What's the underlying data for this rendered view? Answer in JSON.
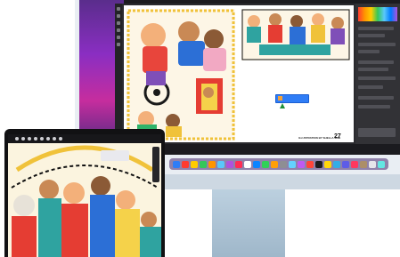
{
  "imac": {
    "app": {
      "artwork_caption": "ILLUSTRATION BY SHELLA SHIE",
      "page_number": "27"
    },
    "dock_icon_colors": [
      "#2e7df6",
      "#ff3b30",
      "#ffcc00",
      "#34c759",
      "#ff9500",
      "#5ac8fa",
      "#af52de",
      "#ff2d55",
      "#ffffff",
      "#0a84ff",
      "#30d158",
      "#ff9f0a",
      "#8e8e93",
      "#64d2ff",
      "#bf5af2",
      "#ff453a",
      "#1c1c1e",
      "#ffd60a",
      "#32ade6",
      "#5e5ce6",
      "#ff375f",
      "#ac8e68",
      "#e5e5ea",
      "#63e6e2"
    ]
  },
  "ipad": {
    "toolbar_buttons": 8
  }
}
